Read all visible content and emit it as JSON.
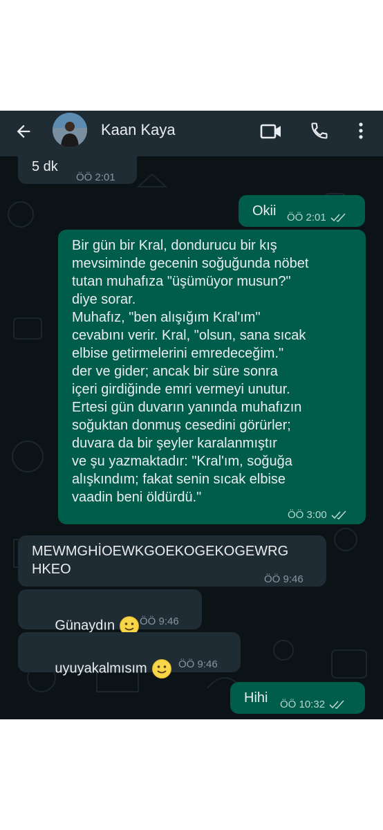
{
  "header": {
    "contact_name": "Kaan Kaya",
    "icons": [
      "back-arrow-icon",
      "video-call-icon",
      "phone-icon",
      "more-vert-icon"
    ]
  },
  "messages": [
    {
      "direction": "in",
      "text": "5 dk",
      "time": "ÖÖ 2:01"
    },
    {
      "direction": "out",
      "text": "Okii",
      "time": "ÖÖ 2:01",
      "status": "read"
    },
    {
      "direction": "out",
      "text": "Bir gün bir Kral, dondurucu bir kış\nmevsiminde gecenin soğuğunda nöbet\ntutan muhafıza \"üşümüyor musun?\"\ndiye sorar.\nMuhafız, \"ben alışığım Kral'ım\"\ncevabını verir. Kral, \"olsun, sana sıcak\nelbise getirmelerini emredeceğim.\"\nder ve gider; ancak bir süre sonra\niçeri girdiğinde emri vermeyi unutur.\nErtesi gün duvarın yanında muhafızın\nsoğuktan donmuş cesedini görürler;\nduvara da bir şeyler karalanmıştır\nve şu yazmaktadır: \"Kral'ım, soğuğa\nalışkındım; fakat senin sıcak elbise\nvaadin beni öldürdü.\"",
      "time": "ÖÖ 3:00",
      "status": "read"
    },
    {
      "direction": "in",
      "text": "MEWMGHİOEWKGOEKOGEKOGEWRG\nHKEO",
      "time": "ÖÖ 9:46"
    },
    {
      "direction": "in",
      "text": "Günaydın",
      "emoji": "slightly-smiling-face",
      "time": "ÖÖ 9:46"
    },
    {
      "direction": "in",
      "text": "uyuyakalmısım",
      "emoji": "slightly-smiling-face",
      "time": "ÖÖ 9:46"
    },
    {
      "direction": "out",
      "text": "Hihi",
      "time": "ÖÖ 10:32",
      "status": "read"
    }
  ],
  "colors": {
    "header_bg": "#1f2c34",
    "chat_bg": "#0c1317",
    "incoming_bubble": "#202c33",
    "outgoing_bubble": "#005c4b",
    "read_ticks": "#b7d6cf"
  }
}
